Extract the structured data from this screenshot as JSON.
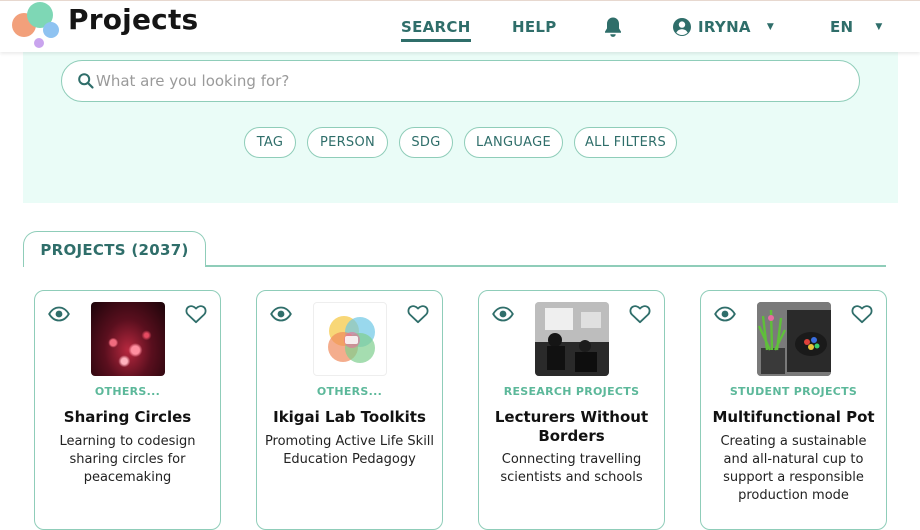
{
  "header": {
    "brand": "Projects",
    "nav": {
      "search": "SEARCH",
      "help": "HELP",
      "user": "IRYNA",
      "lang": "EN"
    }
  },
  "search": {
    "placeholder": "What are you looking for?",
    "value": "",
    "filters": [
      "TAG",
      "PERSON",
      "SDG",
      "LANGUAGE",
      "ALL FILTERS"
    ]
  },
  "tab": {
    "label": "PROJECTS (2037)"
  },
  "cards": [
    {
      "category": "OTHERS...",
      "title": "Sharing Circles",
      "description": "Learning to codesign sharing circles for peacemaking"
    },
    {
      "category": "OTHERS...",
      "title": "Ikigai Lab Toolkits",
      "description": "Promoting Active Life Skill Education Pedagogy"
    },
    {
      "category": "RESEARCH PROJECTS",
      "title": "Lecturers Without Borders",
      "description": "Connecting travelling scientists and schools"
    },
    {
      "category": "STUDENT PROJECTS",
      "title": "Multifunctional Pot",
      "description": "Creating a sustainable and all-natural cup to support a responsible production mode"
    }
  ],
  "colors": {
    "accent": "#2f6e6a",
    "border": "#8fcdb9",
    "category": "#5cb89a",
    "panel": "#eafcf7"
  }
}
